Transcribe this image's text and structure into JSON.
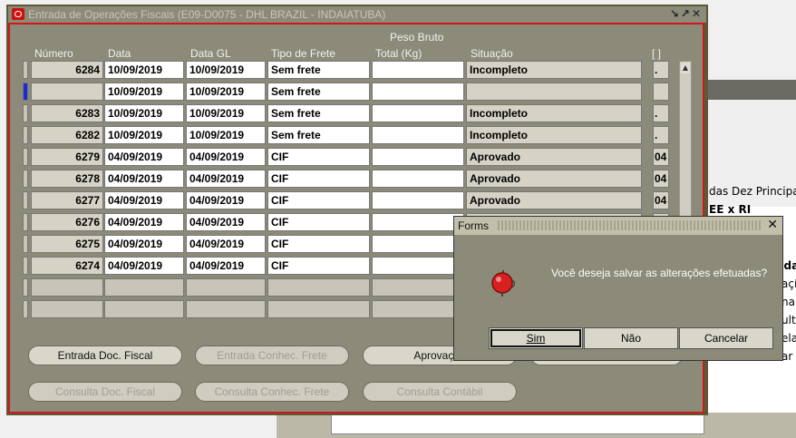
{
  "window": {
    "title": "Entrada de Operações Fiscais (E09-D0075 - DHL BRAZIL - INDAIATUBA)"
  },
  "columns": {
    "numero": "Número",
    "data": "Data",
    "data_gl": "Data GL",
    "tipo_frete": "Tipo de Frete",
    "peso_line1": "Peso Bruto",
    "peso_line2": "Total (Kg)",
    "situacao": "Situação",
    "extra": "[ ]"
  },
  "rows": [
    {
      "numero": "6284",
      "data": "10/09/2019",
      "data_gl": "10/09/2019",
      "tipo": "Sem frete",
      "peso": "",
      "situacao": "Incompleto",
      "extra": "."
    },
    {
      "numero": "",
      "data": "10/09/2019",
      "data_gl": "10/09/2019",
      "tipo": "Sem frete",
      "peso": "",
      "situacao": "",
      "extra": ""
    },
    {
      "numero": "6283",
      "data": "10/09/2019",
      "data_gl": "10/09/2019",
      "tipo": "Sem frete",
      "peso": "",
      "situacao": "Incompleto",
      "extra": "."
    },
    {
      "numero": "6282",
      "data": "10/09/2019",
      "data_gl": "10/09/2019",
      "tipo": "Sem frete",
      "peso": "",
      "situacao": "Incompleto",
      "extra": "."
    },
    {
      "numero": "6279",
      "data": "04/09/2019",
      "data_gl": "04/09/2019",
      "tipo": "CIF",
      "peso": "",
      "situacao": "Aprovado",
      "extra": "04"
    },
    {
      "numero": "6278",
      "data": "04/09/2019",
      "data_gl": "04/09/2019",
      "tipo": "CIF",
      "peso": "",
      "situacao": "Aprovado",
      "extra": "04"
    },
    {
      "numero": "6277",
      "data": "04/09/2019",
      "data_gl": "04/09/2019",
      "tipo": "CIF",
      "peso": "",
      "situacao": "Aprovado",
      "extra": "04"
    },
    {
      "numero": "6276",
      "data": "04/09/2019",
      "data_gl": "04/09/2019",
      "tipo": "CIF",
      "peso": "",
      "situacao": "",
      "extra": ""
    },
    {
      "numero": "6275",
      "data": "04/09/2019",
      "data_gl": "04/09/2019",
      "tipo": "CIF",
      "peso": "",
      "situacao": "",
      "extra": ""
    },
    {
      "numero": "6274",
      "data": "04/09/2019",
      "data_gl": "04/09/2019",
      "tipo": "CIF",
      "peso": "",
      "situacao": "",
      "extra": ""
    }
  ],
  "buttons": {
    "entrada_doc": "Entrada Doc. Fiscal",
    "entrada_conhec": "Entrada Conhec. Frete",
    "aprovacao": "Aprovação",
    "consulta_doc": "Consulta Doc. Fiscal",
    "consulta_conhec": "Consulta Conhec. Frete",
    "consulta_contabil": "Consulta Contábil"
  },
  "dialog": {
    "title": "Forms",
    "message": "Você deseja salvar as alterações efetuadas?",
    "sim": "Sim",
    "nao": "Não",
    "cancelar": "Cancelar",
    "icon": "alarm-bell-icon"
  },
  "background": {
    "labels": [
      "das Dez Principal",
      "EE x RI",
      "uda",
      "açí",
      "na",
      "ult",
      "ela",
      "ar"
    ]
  },
  "colors": {
    "window_bg": "#8c8a78",
    "focus_border": "#d01818",
    "active_row": "#1e2ad8"
  }
}
